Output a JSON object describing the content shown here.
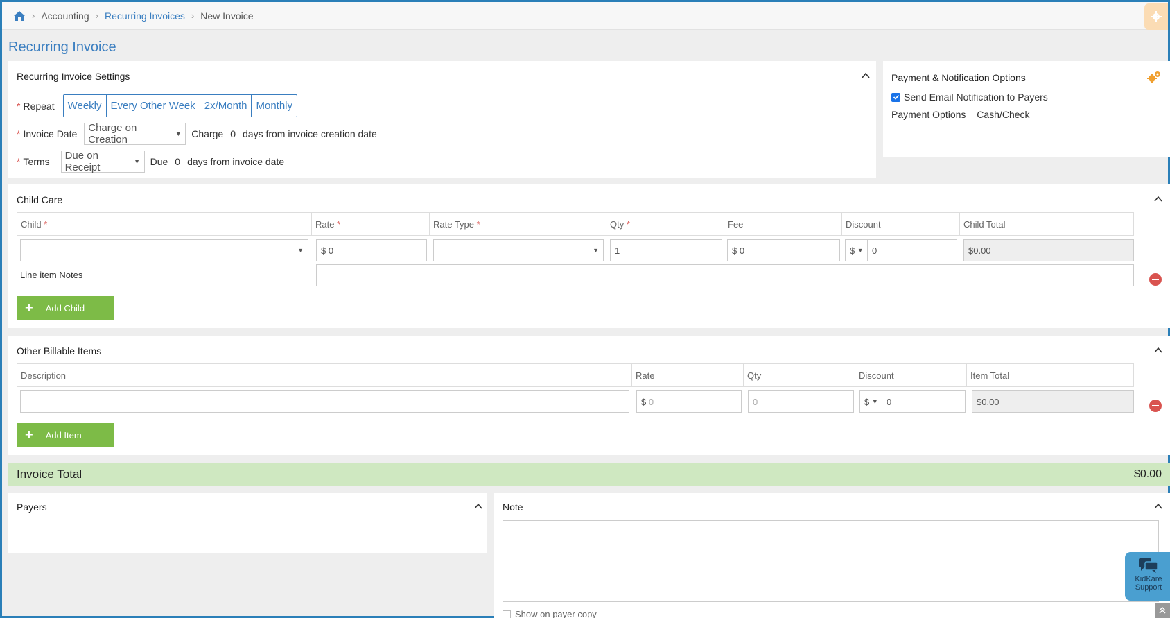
{
  "breadcrumb": {
    "accounting": "Accounting",
    "recurring": "Recurring Invoices",
    "current": "New Invoice"
  },
  "page_title": "Recurring Invoice",
  "settings": {
    "title": "Recurring Invoice Settings",
    "repeat_label": "Repeat",
    "repeat_options": [
      "Weekly",
      "Every Other Week",
      "2x/Month",
      "Monthly"
    ],
    "invoice_date_label": "Invoice Date",
    "invoice_date_value": "Charge on Creation",
    "charge_prefix": "Charge",
    "charge_days": "0",
    "charge_suffix": "days from invoice creation date",
    "terms_label": "Terms",
    "terms_value": "Due on Receipt",
    "due_prefix": "Due",
    "due_days": "0",
    "due_suffix": "days from invoice date"
  },
  "payment": {
    "title": "Payment & Notification Options",
    "send_email_label": "Send Email Notification to Payers",
    "send_email_checked": true,
    "options_label": "Payment Options",
    "options_value": "Cash/Check"
  },
  "child_care": {
    "title": "Child Care",
    "columns": [
      "Child",
      "Rate",
      "Rate Type",
      "Qty",
      "Fee",
      "Discount",
      "Child Total"
    ],
    "row": {
      "rate": "0",
      "qty": "1",
      "fee": "0",
      "discount_type": "$",
      "discount": "0",
      "total": "$0.00",
      "currency": "$"
    },
    "notes_label": "Line item Notes",
    "add_label": "Add Child"
  },
  "other_items": {
    "title": "Other Billable Items",
    "columns": [
      "Description",
      "Rate",
      "Qty",
      "Discount",
      "Item Total"
    ],
    "row": {
      "rate_placeholder": "0",
      "qty_placeholder": "0",
      "discount_type": "$",
      "discount": "0",
      "total": "$0.00",
      "currency": "$"
    },
    "add_label": "Add Item"
  },
  "invoice_total": {
    "label": "Invoice Total",
    "value": "$0.00"
  },
  "payers": {
    "title": "Payers"
  },
  "note": {
    "title": "Note",
    "show_on_payer_label": "Show on payer copy"
  },
  "support": {
    "label_line1": "KidKare",
    "label_line2": "Support"
  },
  "colors": {
    "accent": "#3a7ec0",
    "green": "#7dbb47",
    "total_bar": "#cfe8c1",
    "required": "#d9534f",
    "gear": "#f0a030"
  }
}
